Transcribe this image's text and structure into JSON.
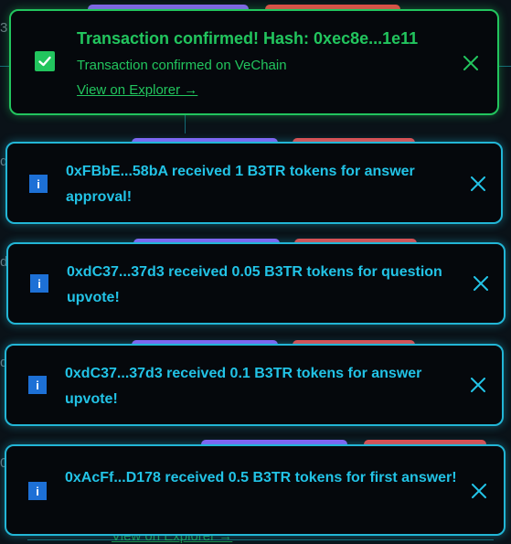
{
  "colors": {
    "success": "#22c55e",
    "info": "#22c3e6",
    "info_icon_bg": "#1d70d6",
    "toast_bg": "#05080c",
    "page_bg": "#0a1218",
    "pill_purple": "#8b5cf6",
    "pill_red": "#ef4444"
  },
  "success_toast": {
    "icon": "checkmark-icon",
    "title": "Transaction confirmed! Hash: 0xec8e...1e11",
    "message": "Transaction confirmed on VeChain",
    "link_label": "View on Explorer →",
    "close_icon": "close-icon"
  },
  "info_toasts": [
    {
      "icon": "info-icon",
      "icon_label": "i",
      "message": "0xFBbE...58bA received 1 B3TR tokens for answer approval!",
      "close_icon": "close-icon"
    },
    {
      "icon": "info-icon",
      "icon_label": "i",
      "message": "0xdC37...37d3 received 0.05 B3TR tokens for question upvote!",
      "close_icon": "close-icon"
    },
    {
      "icon": "info-icon",
      "icon_label": "i",
      "message": "0xdC37...37d3 received 0.1 B3TR tokens for answer upvote!",
      "close_icon": "close-icon"
    },
    {
      "icon": "info-icon",
      "icon_label": "i",
      "message": "0xAcFf...D178 received 0.5 B3TR tokens for first answer!",
      "close_icon": "close-icon"
    }
  ],
  "background": {
    "partial_link": "View on Explorer →"
  }
}
